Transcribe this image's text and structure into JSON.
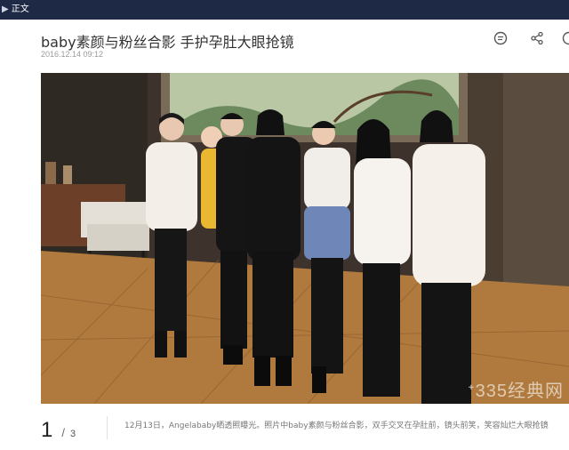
{
  "topbar": {
    "separator": "▶",
    "crumb": "正文"
  },
  "article": {
    "title": "baby素颜与粉丝合影 手护孕肚大眼抢镜",
    "date": "2016.12.14 09:12"
  },
  "toolbar": {
    "icons": [
      "comment-icon",
      "share-icon",
      "more-icon"
    ]
  },
  "photo": {
    "watermark": "ᐩ335经典网",
    "colors": {
      "floor": "#b07a3e",
      "wall": "#3d332c",
      "painting": "#b9c7a4"
    }
  },
  "pager": {
    "current": "1",
    "separator": "/",
    "total": "3"
  },
  "caption": "12月13日，Angelababy晒透照曝光。照片中baby素颜与粉丝合影，双手交叉在孕肚前，镜头前笑，笑容灿烂大眼抢镜"
}
